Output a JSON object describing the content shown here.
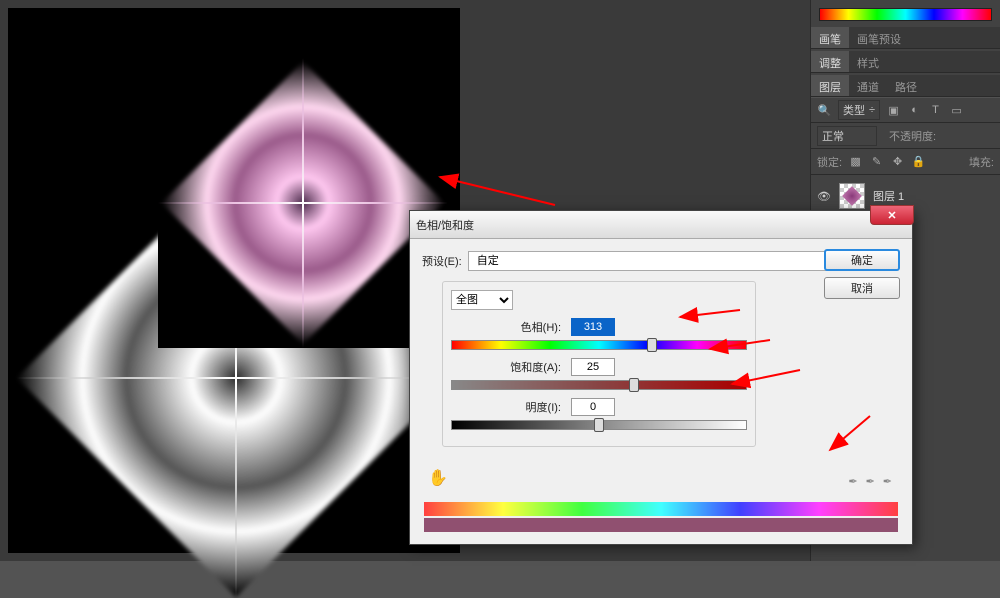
{
  "brush": {
    "tab1": "画笔",
    "tab2": "画笔预设"
  },
  "adjust": {
    "tab1": "调整",
    "tab2": "样式"
  },
  "layers_panel": {
    "tab_layers": "图层",
    "tab_channels": "通道",
    "tab_paths": "路径",
    "kind_label": "类型",
    "blend_mode": "正常",
    "opacity_label": "不透明度:",
    "lock_label": "锁定:",
    "fill_label": "填充:",
    "layer1_name": "图层 1"
  },
  "dialog": {
    "title": "色相/饱和度",
    "preset_label": "预设(E):",
    "preset_value": "自定",
    "ok": "确定",
    "cancel": "取消",
    "range_value": "全图",
    "hue_label": "色相(H):",
    "hue_value": "313",
    "sat_label": "饱和度(A):",
    "sat_value": "25",
    "lig_label": "明度(I):",
    "lig_value": "0"
  }
}
